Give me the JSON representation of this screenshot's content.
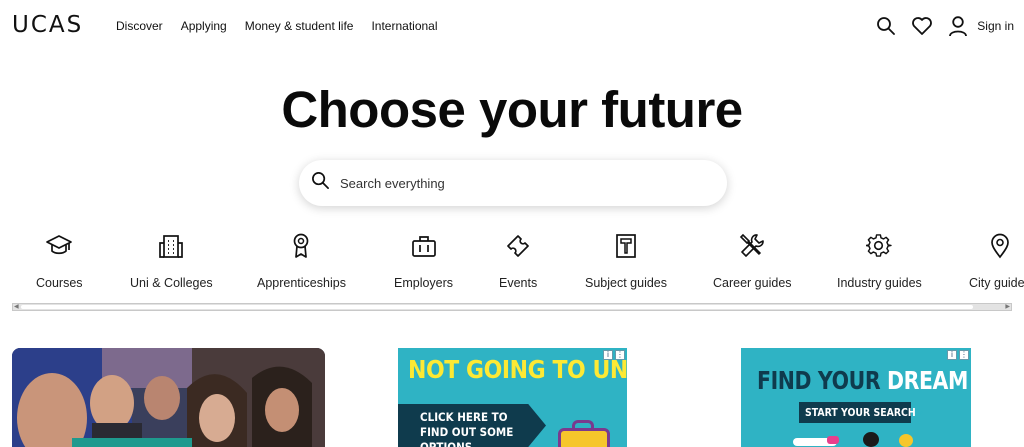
{
  "header": {
    "logo": "UCAS",
    "nav": [
      "Discover",
      "Applying",
      "Money & student life",
      "International"
    ],
    "sign_in": "Sign in"
  },
  "hero": {
    "title": "Choose your future",
    "search_placeholder": "Search everything"
  },
  "categories": [
    {
      "label": "Courses",
      "icon": "graduation-cap-icon"
    },
    {
      "label": "Uni & Colleges",
      "icon": "building-icon"
    },
    {
      "label": "Apprenticeships",
      "icon": "award-badge-icon"
    },
    {
      "label": "Employers",
      "icon": "briefcase-icon"
    },
    {
      "label": "Events",
      "icon": "ticket-icon"
    },
    {
      "label": "Subject guides",
      "icon": "book-icon"
    },
    {
      "label": "Career guides",
      "icon": "tools-icon"
    },
    {
      "label": "Industry guides",
      "icon": "gear-icon"
    },
    {
      "label": "City guides",
      "icon": "map-pin-icon"
    }
  ],
  "ads": [
    {
      "headline": "NOT GOING TO UNI?",
      "cta": "CLICK HERE TO FIND OUT SOME OPTIONS"
    },
    {
      "headline_a": "FIND YOUR",
      "headline_b": "DREAM UNI",
      "cta": "START YOUR SEARCH"
    }
  ],
  "colors": {
    "ad_bg": "#2fb3c4",
    "ad_title_yellow": "#fde934",
    "ad_cta_bg": "#0f3b4d",
    "text": "#111111"
  }
}
